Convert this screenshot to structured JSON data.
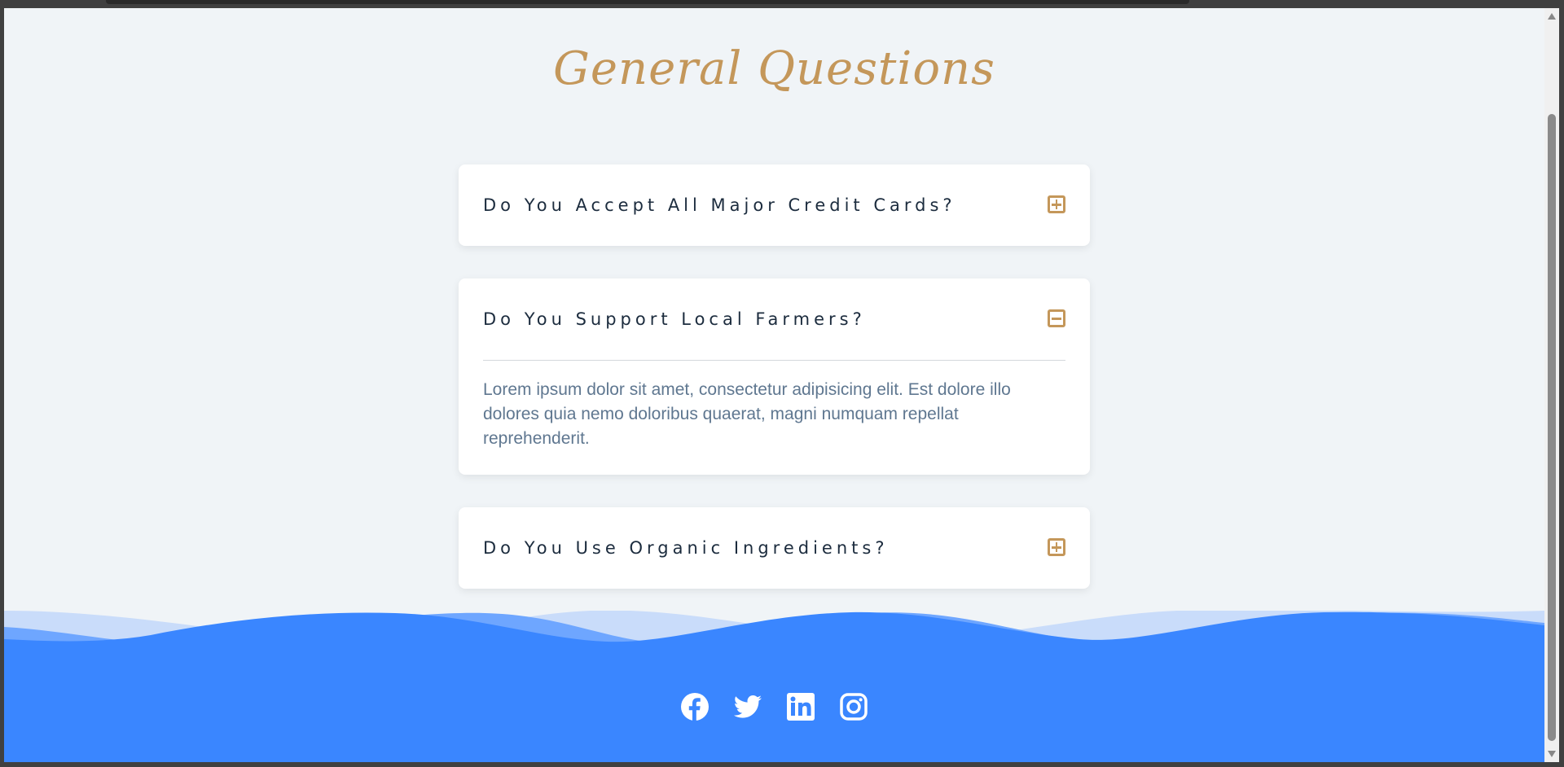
{
  "page": {
    "title": "General Questions"
  },
  "faqs": [
    {
      "question": "Do You Accept All Major Credit Cards?",
      "expanded": false,
      "toggle_icon": "plus-square-icon"
    },
    {
      "question": "Do You Support Local Farmers?",
      "expanded": true,
      "toggle_icon": "minus-square-icon",
      "answer": "Lorem ipsum dolor sit amet, consectetur adipisicing elit. Est dolore illo dolores quia nemo doloribus quaerat, magni numquam repellat reprehenderit."
    },
    {
      "question": "Do You Use Organic Ingredients?",
      "expanded": false,
      "toggle_icon": "plus-square-icon"
    }
  ],
  "footer": {
    "social_icons": [
      "facebook-icon",
      "twitter-icon",
      "linkedin-icon",
      "instagram-icon"
    ]
  },
  "colors": {
    "background": "#f0f4f7",
    "accent_gold": "#c4975a",
    "question_text": "#1c2c3e",
    "answer_text": "#5f7790",
    "footer_blue": "#3a86ff"
  }
}
